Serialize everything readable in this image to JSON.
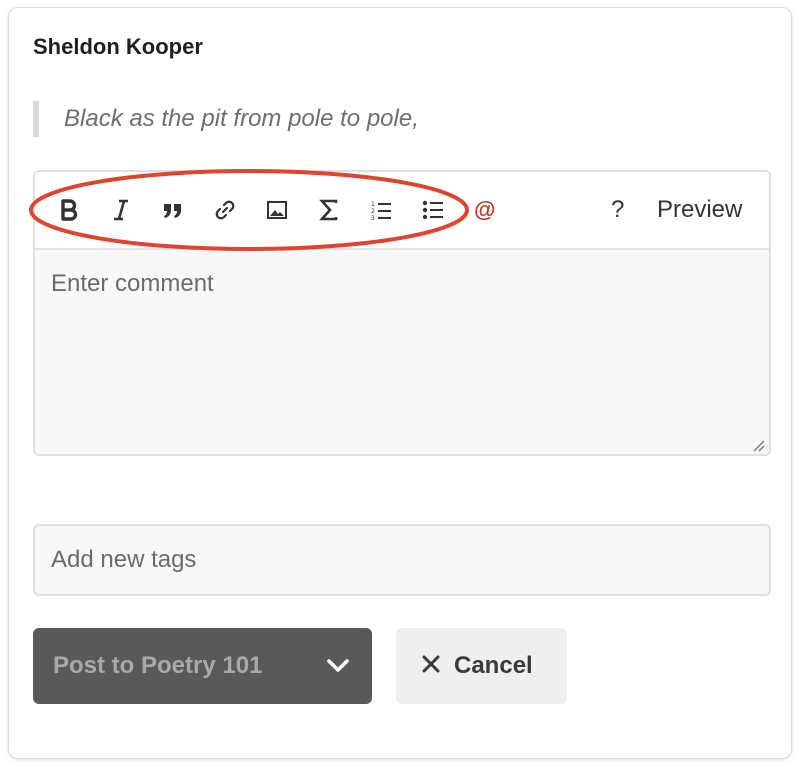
{
  "post": {
    "author": "Sheldon Kooper",
    "quote": "Black as the pit from pole to pole,"
  },
  "toolbar": {
    "buttons": [
      "bold-icon",
      "italic-icon",
      "blockquote-icon",
      "link-icon",
      "image-icon",
      "sigma-icon",
      "numbered-list-icon",
      "bullet-list-icon"
    ],
    "mention_label": "@",
    "help_label": "?",
    "preview_label": "Preview"
  },
  "composer": {
    "placeholder": "Enter comment",
    "value": ""
  },
  "tags": {
    "placeholder": "Add new tags"
  },
  "actions": {
    "post_label": "Post to Poetry 101",
    "cancel_label": "Cancel"
  },
  "colors": {
    "annotation": "#e0432f",
    "mention": "#c0392b",
    "post_button_bg": "#595959",
    "cancel_button_bg": "#efefef"
  }
}
